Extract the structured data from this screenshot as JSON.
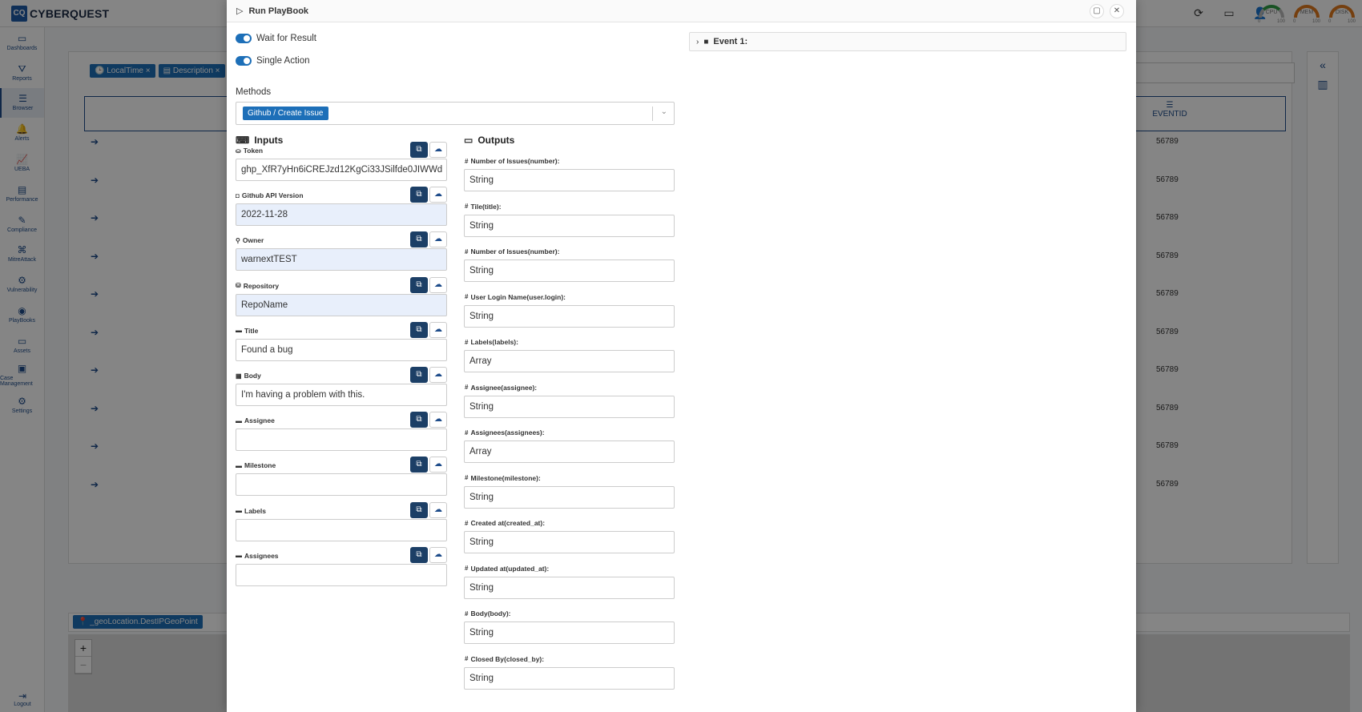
{
  "app": {
    "logo_mark": "CQ",
    "logo_text": "CYBERQUEST",
    "gauges": [
      {
        "label": "CPU",
        "min": "0",
        "max": "100"
      },
      {
        "label": "MEM",
        "min": "0",
        "max": "100"
      },
      {
        "label": "DISK",
        "min": "0",
        "max": "100"
      }
    ]
  },
  "sidebar": {
    "items": [
      {
        "label": "Dashboards",
        "icon": "▭"
      },
      {
        "label": "Reports",
        "icon": "⛛"
      },
      {
        "label": "Browser",
        "icon": "☰"
      },
      {
        "label": "Alerts",
        "icon": "🔔"
      },
      {
        "label": "UEBA",
        "icon": "📈"
      },
      {
        "label": "Performance",
        "icon": "▤"
      },
      {
        "label": "Compliance",
        "icon": "✎"
      },
      {
        "label": "MitreAttack",
        "icon": "⌘"
      },
      {
        "label": "Vulnerability",
        "icon": "⚙"
      },
      {
        "label": "PlayBooks",
        "icon": "◉"
      },
      {
        "label": "Assets",
        "icon": "▭"
      },
      {
        "label": "Case Management",
        "icon": "▣"
      },
      {
        "label": "Settings",
        "icon": "⚙"
      }
    ],
    "logout": "Logout"
  },
  "background": {
    "chips": [
      "LocalTime",
      "Description"
    ],
    "eventid_header": "EVENTID",
    "rows": [
      "56789",
      "56789",
      "56789",
      "56789",
      "56789",
      "56789",
      "56789",
      "56789",
      "56789",
      "56789"
    ],
    "geo_chip": "_geoLocation.DestIPGeoPoint",
    "zoom_in": "+",
    "zoom_out": "−"
  },
  "modal": {
    "title": "Run PlayBook",
    "wait_for_result": "Wait for Result",
    "single_action": "Single Action",
    "methods_label": "Methods",
    "method_selected": "Github / Create Issue",
    "inputs_title": "Inputs",
    "outputs_title": "Outputs",
    "event_title": "Event 1:",
    "inputs": [
      {
        "label": "Token",
        "value": "ghp_XfR7yHn6iCREJzd12KgCi33JSilfde0JIWWd",
        "filled": false
      },
      {
        "label": "Github API Version",
        "value": "2022-11-28",
        "filled": true
      },
      {
        "label": "Owner",
        "value": "warnextTEST",
        "filled": true
      },
      {
        "label": "Repository",
        "value": "RepoName",
        "filled": true
      },
      {
        "label": "Title",
        "value": "Found a bug",
        "filled": false
      },
      {
        "label": "Body",
        "value": "I'm having a problem with this.",
        "filled": false
      },
      {
        "label": "Assignee",
        "value": "",
        "filled": false
      },
      {
        "label": "Milestone",
        "value": "",
        "filled": false
      },
      {
        "label": "Labels",
        "value": "",
        "filled": false
      },
      {
        "label": "Assignees",
        "value": "",
        "filled": false
      }
    ],
    "outputs": [
      {
        "label": "Number of Issues(number):",
        "value": "String"
      },
      {
        "label": "Tile(title):",
        "value": "String"
      },
      {
        "label": "Number of Issues(number):",
        "value": "String"
      },
      {
        "label": "User Login Name(user.login):",
        "value": "String"
      },
      {
        "label": "Labels(labels):",
        "value": "Array"
      },
      {
        "label": "Assignee(assignee):",
        "value": "String"
      },
      {
        "label": "Assignees(assignees):",
        "value": "Array"
      },
      {
        "label": "Milestone(milestone):",
        "value": "String"
      },
      {
        "label": "Created at(created_at):",
        "value": "String"
      },
      {
        "label": "Updated at(updated_at):",
        "value": "String"
      },
      {
        "label": "Body(body):",
        "value": "String"
      },
      {
        "label": "Closed By(closed_by):",
        "value": "String"
      }
    ]
  }
}
